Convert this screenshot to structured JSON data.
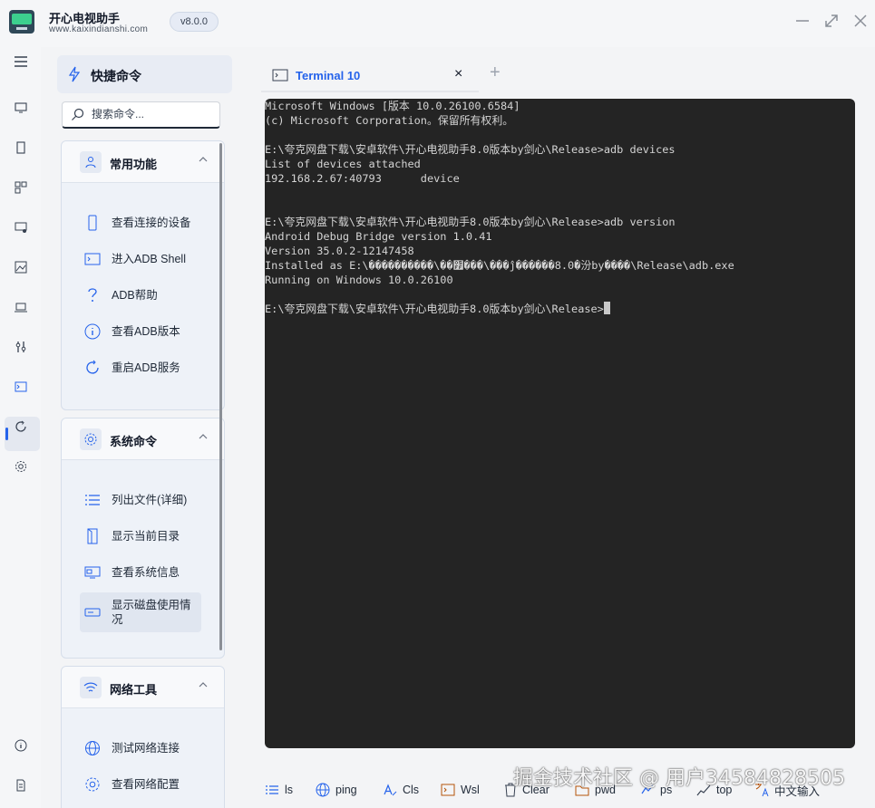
{
  "app": {
    "title": "开心电视助手",
    "url": "www.kaixindianshi.com",
    "version": "v8.0.0"
  },
  "window_controls": [
    "minimize-icon",
    "maximize-icon",
    "close-icon"
  ],
  "rail_icons": [
    "menu-icon",
    "monitor-icon",
    "phone-icon",
    "apps-icon",
    "screen-cast-icon",
    "image-icon",
    "laptop-icon",
    "tools-icon",
    "terminal-icon",
    "refresh-icon",
    "settings-icon",
    "info-icon",
    "document-icon"
  ],
  "panel": {
    "title": "快捷命令",
    "search_placeholder": "搜索命令...",
    "groups": [
      {
        "title": "常用功能",
        "items": [
          "查看连接的设备",
          "进入ADB Shell",
          "ADB帮助",
          "查看ADB版本",
          "重启ADB服务"
        ]
      },
      {
        "title": "系统命令",
        "items": [
          "列出文件(详细)",
          "显示当前目录",
          "查看系统信息",
          "显示磁盘使用情况"
        ]
      },
      {
        "title": "网络工具",
        "items": [
          "测试网络连接",
          "查看网络配置"
        ]
      }
    ]
  },
  "tab": {
    "label": "Terminal 10",
    "close": "×",
    "add": "+"
  },
  "terminal": {
    "lines": [
      "Microsoft Windows [版本 10.0.26100.6584]",
      "(c) Microsoft Corporation。保留所有权利。",
      "",
      "E:\\夸克网盘下载\\安卓软件\\开心电视助手8.0版本by剑心\\Release>adb devices",
      "List of devices attached",
      "192.168.2.67:40793      device",
      "",
      "",
      "E:\\夸克网盘下载\\安卓软件\\开心电视助手8.0版本by剑心\\Release>adb version",
      "Android Debug Bridge version 1.0.41",
      "Version 35.0.2-12147458",
      "Installed as E:\\����������\\��׿���\\���ĵ������8.0�汾by����\\Release\\adb.exe",
      "Running on Windows 10.0.26100",
      "",
      "E:\\夸克网盘下载\\安卓软件\\开心电视助手8.0版本by剑心\\Release>"
    ]
  },
  "bottom_bar": [
    {
      "label": "ls",
      "icon": "list-icon"
    },
    {
      "label": "ping",
      "icon": "globe-icon"
    },
    {
      "label": "Cls",
      "icon": "clear-screen-icon"
    },
    {
      "label": "Wsl",
      "icon": "terminal-icon"
    },
    {
      "label": "Clear",
      "icon": "trash-icon"
    },
    {
      "label": "pwd",
      "icon": "folder-icon"
    },
    {
      "label": "ps",
      "icon": "process-icon"
    },
    {
      "label": "top",
      "icon": "chart-icon"
    },
    {
      "label": "中文输入",
      "icon": "translate-icon"
    }
  ],
  "watermark": "掘金技术社区 @ 用户34584828505"
}
